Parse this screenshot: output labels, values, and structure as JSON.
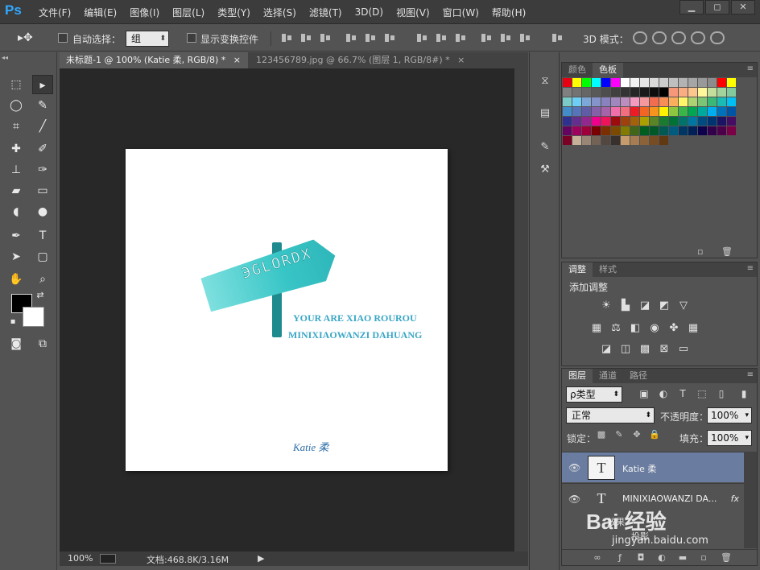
{
  "app": {
    "logo": "Ps"
  },
  "menu": [
    "文件(F)",
    "编辑(E)",
    "图像(I)",
    "图层(L)",
    "类型(Y)",
    "选择(S)",
    "滤镜(T)",
    "3D(D)",
    "视图(V)",
    "窗口(W)",
    "帮助(H)"
  ],
  "window_controls": {
    "minimize": "▁",
    "restore": "◻",
    "close": "✕"
  },
  "options": {
    "auto_select_label": "自动选择：",
    "auto_select_value": "组",
    "transform_label": "显示变换控件",
    "mode3d_label": "3D 模式："
  },
  "tabs": [
    {
      "label": "未标题-1 @ 100% (Katie 柔, RGB/8) *",
      "close": "×"
    },
    {
      "label": "123456789.jpg @ 66.7% (图层 1, RGB/8#) *",
      "close": "×"
    }
  ],
  "canvas": {
    "sign_text": "ЭGLORDX",
    "slogan_line1": "YOUR ARE XIAO ROUROU",
    "slogan_line2": "MINIXIAOWANZI DAHUANG",
    "signature": "Katie 柔"
  },
  "status": {
    "zoom": "100%",
    "doc_label": "文档:468.8K/3.16M",
    "arrow": "▶"
  },
  "color_panel": {
    "tabs": [
      "颜色",
      "色板"
    ],
    "active": "色板"
  },
  "swatches": [
    "#e60012",
    "#ffff00",
    "#00ff00",
    "#00ffff",
    "#0000ff",
    "#ff00ff",
    "#ffffff",
    "#f2f2f2",
    "#e6e6e6",
    "#d9d9d9",
    "#cccccc",
    "#bfbfbf",
    "#b3b3b3",
    "#a6a6a6",
    "#999999",
    "#8c8c8c",
    "#ff0000",
    "#ffff00",
    "#808080",
    "#737373",
    "#666666",
    "#595959",
    "#4d4d4d",
    "#404040",
    "#333333",
    "#262626",
    "#1a1a1a",
    "#0d0d0d",
    "#000000",
    "#f7977a",
    "#fbad82",
    "#fdc68c",
    "#fff799",
    "#c4df9b",
    "#a3d39c",
    "#82ca9c",
    "#7accc8",
    "#6dcff6",
    "#7da7d9",
    "#8493ca",
    "#8882be",
    "#a187be",
    "#bc8dbf",
    "#f49ac1",
    "#f5989d",
    "#f26c4f",
    "#f68e56",
    "#fbaf5d",
    "#fff568",
    "#acd372",
    "#7cc576",
    "#3bb878",
    "#1abbb4",
    "#00bff3",
    "#438cca",
    "#5574b9",
    "#605ca8",
    "#855fa8",
    "#a763a8",
    "#f06ea9",
    "#f26d7d",
    "#ed1c24",
    "#f26522",
    "#f7941d",
    "#fff200",
    "#8dc63f",
    "#39b54a",
    "#00a651",
    "#00a99d",
    "#00aeef",
    "#0072bc",
    "#0054a6",
    "#2e3192",
    "#662d91",
    "#92278f",
    "#ec008c",
    "#ed145b",
    "#9e0b0f",
    "#a0410d",
    "#a36209",
    "#aba000",
    "#598527",
    "#1a7b30",
    "#007236",
    "#00746b",
    "#0076a3",
    "#004b80",
    "#003471",
    "#1b1464",
    "#440e62",
    "#630460",
    "#9e005d",
    "#9e0039",
    "#790000",
    "#7b2e00",
    "#7d4900",
    "#827b00",
    "#406618",
    "#005e20",
    "#005826",
    "#005952",
    "#005b7f",
    "#003663",
    "#002157",
    "#0d004c",
    "#32004b",
    "#4b0049",
    "#7b0046",
    "#7a0026",
    "#c7b299",
    "#998675",
    "#736357",
    "#534741",
    "#37302d",
    "#c69c6d",
    "#a67c52",
    "#8c6239",
    "#754c24",
    "#603913"
  ],
  "adjust_panel": {
    "tabs": [
      "调整",
      "样式"
    ],
    "active": "调整",
    "title": "添加调整"
  },
  "layers_panel": {
    "tabs": [
      "图层",
      "通道",
      "路径"
    ],
    "active": "图层",
    "filter_label": "ρ类型",
    "blend_mode": "正常",
    "opacity_label": "不透明度：",
    "opacity_value": "100%",
    "lock_label": "锁定：",
    "fill_label": "填充：",
    "fill_value": "100%",
    "layers": [
      {
        "name": "Katie 柔",
        "thumb": "T",
        "selected": true
      },
      {
        "name": "MINIXIAOWANZI DA...",
        "thumb": "T",
        "fx": "fx",
        "selected": false
      }
    ],
    "effects_label": "效果",
    "effect_item": "投影"
  },
  "watermark": {
    "brand": "Bai 经验",
    "url": "jingyan.baidu.com"
  },
  "colors": {
    "accent": "#31a8ff",
    "selection": "#6a7da0",
    "teal": "#38c5c6"
  }
}
